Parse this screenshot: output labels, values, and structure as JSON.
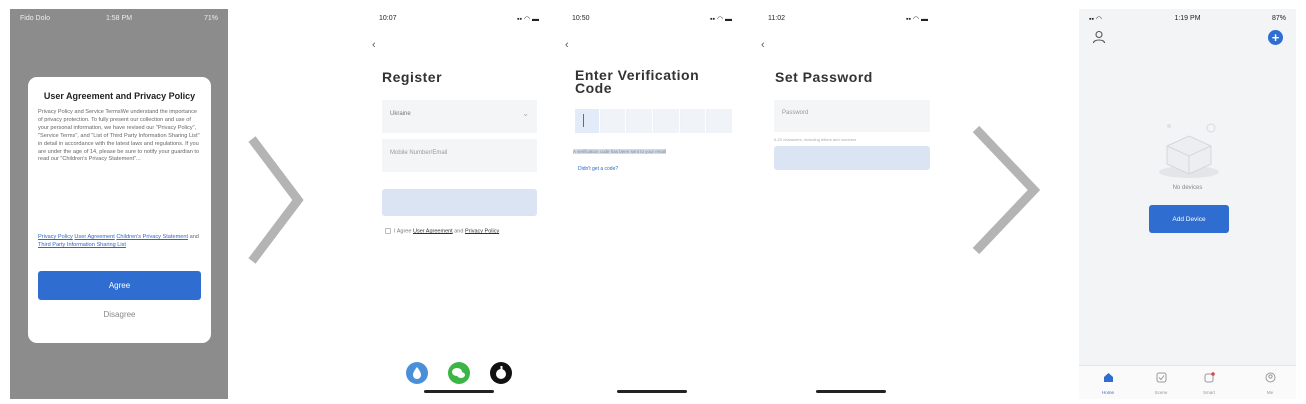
{
  "screen1": {
    "status": {
      "carrier": "Fido Dolo",
      "time": "1:58 PM",
      "battery": "71%"
    },
    "dialog_title": "User Agreement and Privacy Policy",
    "dialog_body": "Privacy Policy and Service TermsWe understand the importance of privacy protection. To fully present our collection and use of your personal information, we have revised our \"Privacy Policy\", \"Service Terms\", and \"List of Third Party Information Sharing List\" in detail in accordance with the latest laws and regulations. If you are under the age of 14, please be sure to notify your guardian to read our \"Children's Privacy Statement\"...",
    "links": {
      "privacy_policy": "Privacy Policy",
      "user_agreement": "User Agreement",
      "childrens_privacy": "Children's Privacy Statement",
      "and": "and",
      "third_party_list": "Third Party Information Sharing List"
    },
    "agree_label": "Agree",
    "disagree_label": "Disagree"
  },
  "screen2": {
    "status": {
      "time": "10:07"
    },
    "back": "‹",
    "title": "Register",
    "region_value": "Ukraine",
    "phone_placeholder": "Mobile Number/Email",
    "terms": {
      "prefix": "I Agree",
      "user_agreement": "User Agreement",
      "and": "and",
      "privacy_policy": "Privacy Policy"
    },
    "social_colors": [
      "#4a90d9",
      "#3cb446",
      "#111111"
    ]
  },
  "screen3": {
    "status": {
      "time": "10:50"
    },
    "back": "‹",
    "title": "Enter Verification Code",
    "hint": "A verification code has been sent to your email",
    "resend": "Didn't get a code?"
  },
  "screen4": {
    "status": {
      "time": "11:02"
    },
    "back": "‹",
    "title": "Set Password",
    "password_placeholder": "Password",
    "password_hint": "6-20 characters, including letters and numbers"
  },
  "screen5": {
    "status": {
      "time": "1:19 PM",
      "battery": "87%"
    },
    "no_devices": "No devices",
    "add_device_label": "Add Device",
    "tabs": [
      {
        "label": "Home",
        "icon": "home-icon"
      },
      {
        "label": "Scene",
        "icon": "scene-icon"
      },
      {
        "label": "Smart",
        "icon": "smart-icon"
      },
      {
        "label": "Me",
        "icon": "me-icon"
      }
    ]
  },
  "colors": {
    "primary_blue": "#2f6dd0",
    "disabled_button": "#dbe4f3",
    "field_bg": "#f4f5f7",
    "overlay_grey": "#8c8c8c",
    "chevron_grey": "#b4b4b4"
  }
}
